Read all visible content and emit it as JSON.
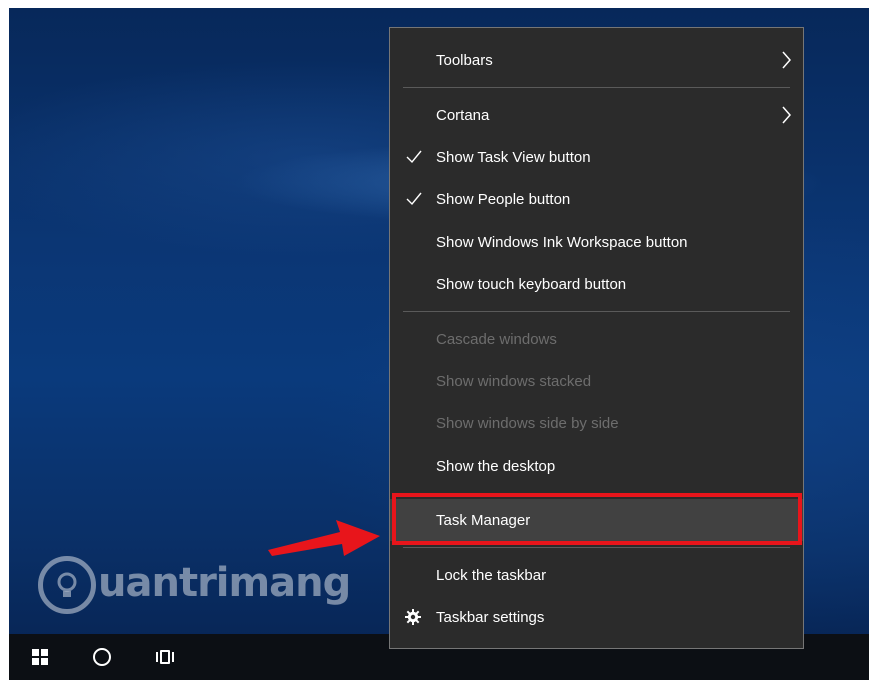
{
  "menu": {
    "items": [
      {
        "label": "Toolbars",
        "submenu": true
      },
      {
        "label": "Cortana",
        "submenu": true
      },
      {
        "label": "Show Task View button",
        "checked": true
      },
      {
        "label": "Show People button",
        "checked": true
      },
      {
        "label": "Show Windows Ink Workspace button"
      },
      {
        "label": "Show touch keyboard button"
      },
      {
        "label": "Cascade windows",
        "disabled": true
      },
      {
        "label": "Show windows stacked",
        "disabled": true
      },
      {
        "label": "Show windows side by side",
        "disabled": true
      },
      {
        "label": "Show the desktop"
      },
      {
        "label": "Task Manager",
        "highlighted": true
      },
      {
        "label": "Lock the taskbar"
      },
      {
        "label": "Taskbar settings",
        "icon": "gear-icon"
      }
    ]
  },
  "watermark": {
    "text": "uantrimang"
  },
  "taskbar": {
    "icons": [
      "windows-start-icon",
      "cortana-search-icon",
      "task-view-icon"
    ]
  },
  "colors": {
    "menu_bg": "#2b2b2b",
    "highlight_border": "#e8151b",
    "arrow": "#e8151b",
    "disabled_text": "#6d6d6d"
  }
}
